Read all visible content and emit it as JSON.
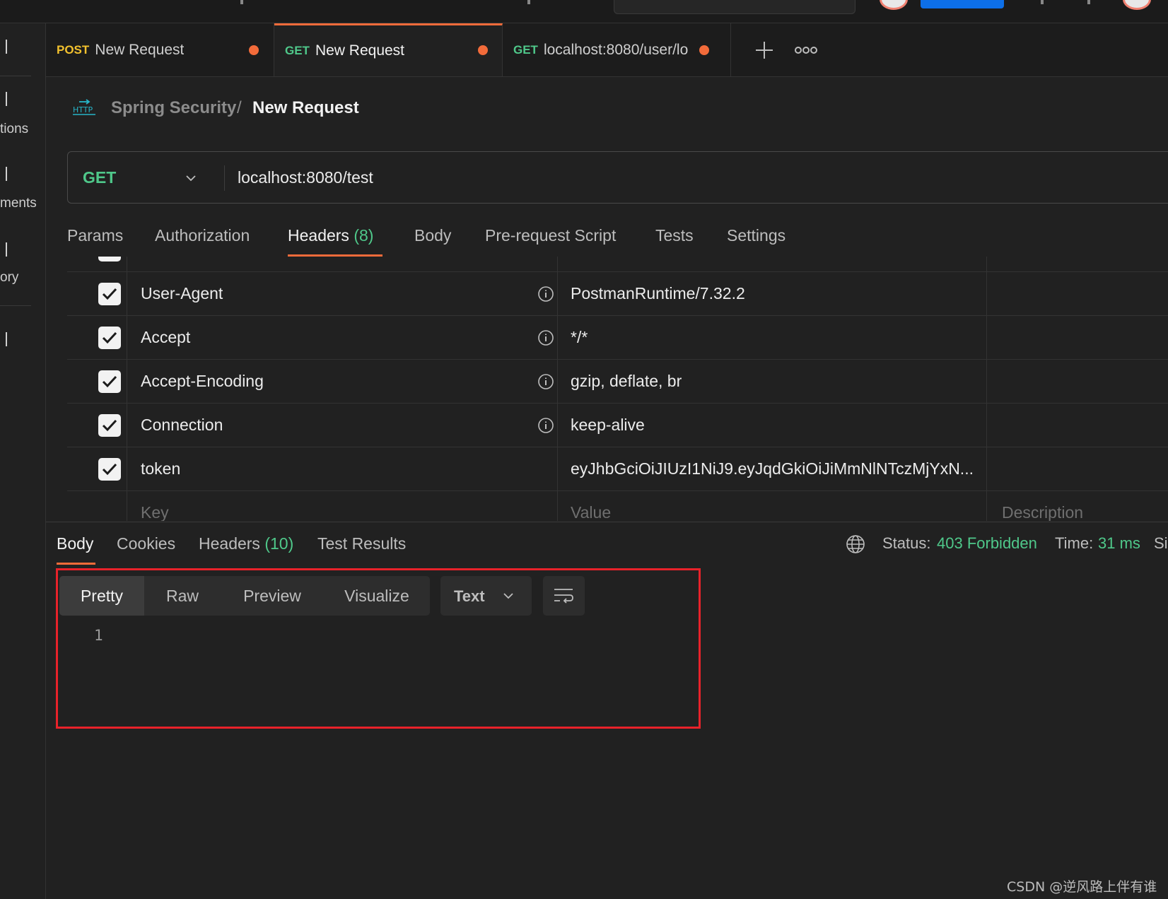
{
  "tabs": [
    {
      "method": "POST",
      "title": "New Request",
      "unsaved": true,
      "active": false
    },
    {
      "method": "GET",
      "title": "New Request",
      "unsaved": true,
      "active": true
    },
    {
      "method": "GET",
      "title": "localhost:8080/user/lo",
      "unsaved": true,
      "active": false
    }
  ],
  "sidebar": {
    "labels": [
      "tions",
      "ments",
      "ory"
    ]
  },
  "breadcrumb": {
    "icon_text": "HTTP",
    "collection": "Spring Security",
    "separator": "/",
    "current": "New Request"
  },
  "request": {
    "method": "GET",
    "url": "localhost:8080/test"
  },
  "request_tabs": {
    "params": "Params",
    "authorization": "Authorization",
    "headers": "Headers",
    "headers_count": "(8)",
    "body": "Body",
    "pre_request": "Pre-request Script",
    "tests": "Tests",
    "settings": "Settings",
    "active": "Headers"
  },
  "headers": [
    {
      "key": "User-Agent",
      "value": "PostmanRuntime/7.32.2",
      "checked": true,
      "info": true
    },
    {
      "key": "Accept",
      "value": "*/*",
      "checked": true,
      "info": true
    },
    {
      "key": "Accept-Encoding",
      "value": "gzip, deflate, br",
      "checked": true,
      "info": true
    },
    {
      "key": "Connection",
      "value": "keep-alive",
      "checked": true,
      "info": true
    },
    {
      "key": "token",
      "value": "eyJhbGciOiJIUzI1NiJ9.eyJqdGkiOiJiMmNlNTczMjYxN...",
      "checked": true,
      "info": false
    }
  ],
  "header_placeholders": {
    "key": "Key",
    "value": "Value",
    "description": "Description"
  },
  "response_tabs": {
    "body": "Body",
    "cookies": "Cookies",
    "headers": "Headers",
    "headers_count": "(10)",
    "test_results": "Test Results",
    "active": "Body"
  },
  "response_status": {
    "status_label": "Status:",
    "status_value": "403 Forbidden",
    "time_label": "Time:",
    "time_value": "31 ms",
    "size_label": "Si"
  },
  "body_view": {
    "modes": [
      "Pretty",
      "Raw",
      "Preview",
      "Visualize"
    ],
    "active_mode": "Pretty",
    "format": "Text",
    "line_numbers": [
      "1"
    ]
  },
  "watermark": "CSDN @逆风路上伴有谁",
  "colors": {
    "accent": "#f26b3a",
    "get_method": "#4fc88a",
    "post_method": "#f2c12e",
    "status_ok": "#4fc88a",
    "highlight_box": "#e8222a",
    "upgrade_button": "#0d6fe8"
  }
}
